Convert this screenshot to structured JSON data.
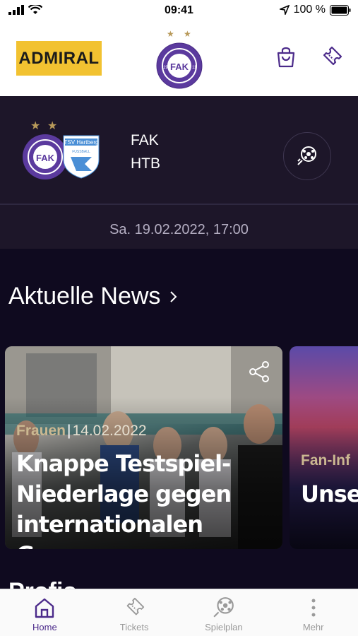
{
  "status_bar": {
    "time": "09:41",
    "battery": "100 %"
  },
  "header": {
    "sponsor": "ADMIRAL",
    "club_logo_text": {
      "top": "FUSSBALLKLUB",
      "bottom": "AUSTRIA WIEN",
      "center": "FAK",
      "left_digits": "19",
      "right_digits": "11"
    },
    "icons": [
      "cart-icon",
      "ticket-icon"
    ]
  },
  "match": {
    "home": "FAK",
    "away": "HTB",
    "date": "Sa. 19.02.2022, 17:00",
    "away_logo_text": {
      "name": "TSV Hartberg",
      "sub": "FUSSBALL"
    }
  },
  "news": {
    "section_title": "Aktuelle News",
    "cards": [
      {
        "category": "Frauen",
        "date": "14.02.2022",
        "title": "Knappe Testspiel-Niederlage gegen internationalen Gegner"
      },
      {
        "category": "Fan-Inf",
        "date": "",
        "title": "Unser Frühja"
      }
    ]
  },
  "next_section": "Profis",
  "tab_bar": {
    "tabs": [
      {
        "label": "Home",
        "icon": "home-icon",
        "active": true
      },
      {
        "label": "Tickets",
        "icon": "ticket-icon",
        "active": false
      },
      {
        "label": "Spielplan",
        "icon": "football-icon",
        "active": false
      },
      {
        "label": "Mehr",
        "icon": "more-icon",
        "active": false
      }
    ]
  },
  "colors": {
    "brand": "#4b2a8a",
    "gold": "#cbb891",
    "dark_bg": "#0f0a1f",
    "card_bg": "#1d1629"
  }
}
